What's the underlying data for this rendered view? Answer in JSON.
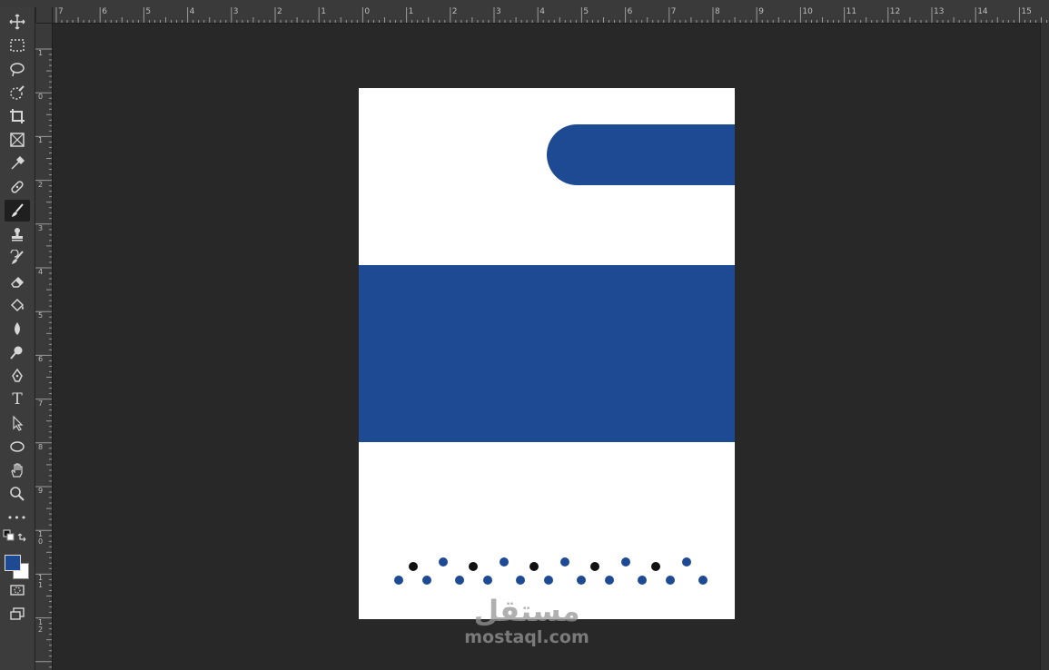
{
  "ruler_top_labels": [
    "7",
    "6",
    "5",
    "4",
    "3",
    "2",
    "1",
    "0",
    "1",
    "2",
    "3",
    "4",
    "5",
    "6",
    "7",
    "8",
    "9",
    "10",
    "11",
    "12",
    "13",
    "14",
    "15"
  ],
  "ruler_left_labels": [
    "1",
    "0",
    "1",
    "2",
    "3",
    "4",
    "5",
    "6",
    "7",
    "8",
    "9",
    "1\n0",
    "1\n1",
    "1\n2"
  ],
  "tools": [
    "move-tool-icon",
    "marquee-tool-icon",
    "lasso-tool-icon",
    "quick-selection-tool-icon",
    "crop-tool-icon",
    "frame-tool-icon",
    "eyedropper-tool-icon",
    "healing-brush-tool-icon",
    "brush-tool-icon",
    "clone-stamp-tool-icon",
    "history-brush-tool-icon",
    "eraser-tool-icon",
    "paint-bucket-tool-icon",
    "blur-tool-icon",
    "dodge-tool-icon",
    "pen-tool-icon",
    "type-tool-icon",
    "path-selection-tool-icon",
    "ellipse-tool-icon",
    "hand-tool-icon",
    "zoom-tool-icon",
    "more-tools-icon"
  ],
  "active_tool": "brush-tool-icon",
  "colors": {
    "foreground": "#1e4a94",
    "background": "#ffffff",
    "accent_blue": "#1e4a94",
    "dot_black": "#111111"
  },
  "type_tool_glyph": "T",
  "more_tools_glyph": "•••",
  "watermark": {
    "arabic": "مستقل",
    "english": "mostaql.com"
  }
}
